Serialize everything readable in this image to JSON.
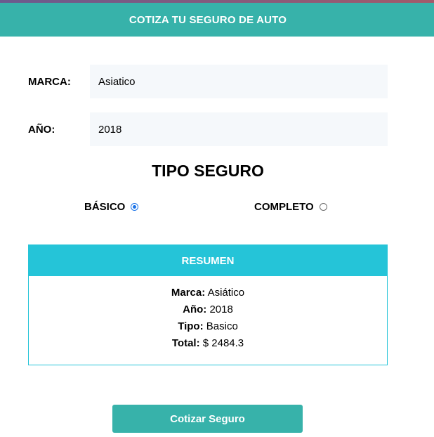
{
  "header": {
    "title": "COTIZA TU SEGURO DE AUTO"
  },
  "form": {
    "marca": {
      "label": "MARCA:",
      "value": "Asiatico"
    },
    "anio": {
      "label": "AÑO:",
      "value": "2018"
    }
  },
  "tipo": {
    "title": "TIPO SEGURO",
    "options": [
      {
        "label": "BÁSICO",
        "checked": true
      },
      {
        "label": "COMPLETO",
        "checked": false
      }
    ]
  },
  "summary": {
    "title": "RESUMEN",
    "marca_label": "Marca:",
    "marca_value": "Asiático",
    "anio_label": "Año:",
    "anio_value": "2018",
    "tipo_label": "Tipo:",
    "tipo_value": "Basico",
    "total_label": "Total:",
    "total_value": "$ 2484.3"
  },
  "button": {
    "label": "Cotizar Seguro"
  },
  "colors": {
    "header_bg": "#37b2aa",
    "summary_accent": "#25c4d8",
    "button_bg": "#37b2aa",
    "radio_checked": "#1a73e8"
  }
}
